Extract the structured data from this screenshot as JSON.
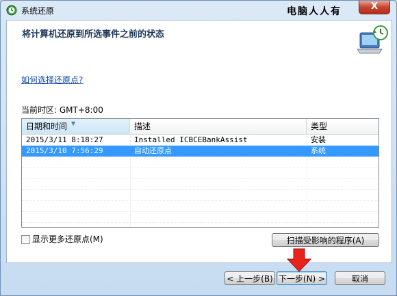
{
  "window": {
    "title": "系统还原",
    "watermark": "电脑人人有",
    "close_label": "X"
  },
  "header": {
    "heading": "将计算机还原到所选事件之前的状态"
  },
  "help_link": "如何选择还原点?",
  "timezone_label": "当前时区: GMT+8:00",
  "table": {
    "columns": [
      "日期和时间",
      "描述",
      "类型"
    ],
    "rows": [
      {
        "date": "2015/3/11 8:18:27",
        "description": "Installed ICBCEBankAssist",
        "type": "安装",
        "selected": false
      },
      {
        "date": "2015/3/10 7:56:29",
        "description": "自动还原点",
        "type": "系统",
        "selected": true
      }
    ]
  },
  "show_more_label": "显示更多还原点(M)",
  "scan_button": "扫描受影响的程序(A)",
  "buttons": {
    "back": "< 上一步(B)",
    "next": "下一步(N) >",
    "cancel": "取消"
  },
  "colors": {
    "selection": "#3399ff",
    "arrow": "#e8231a",
    "heading": "#1e395b"
  },
  "icons": [
    "system-restore-icon",
    "restore-computer-icon",
    "sort-arrow-icon",
    "red-down-arrow-icon"
  ]
}
